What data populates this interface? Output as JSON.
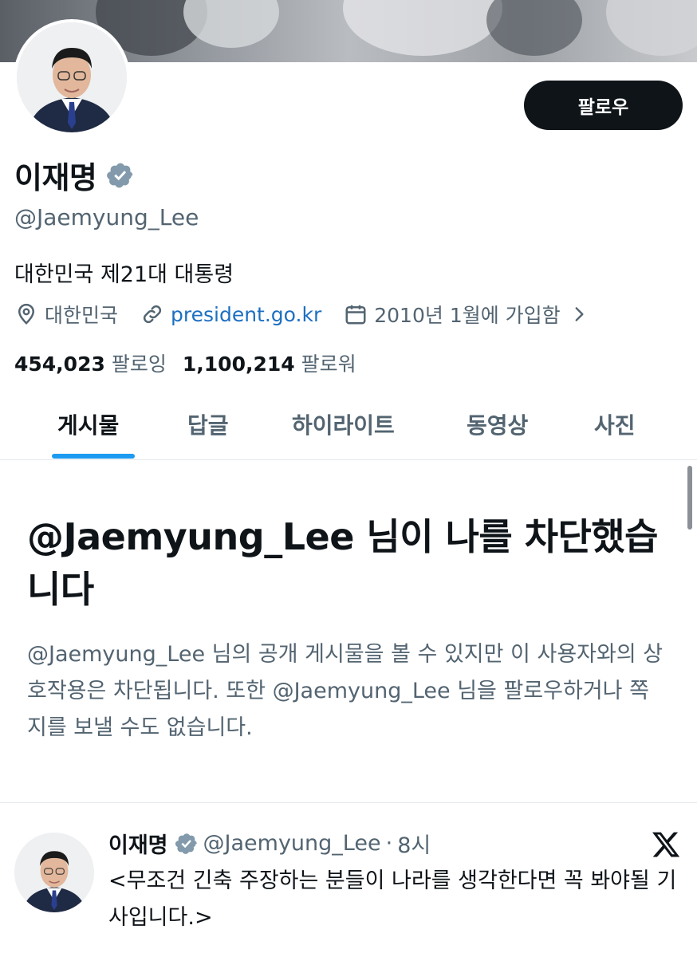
{
  "profile": {
    "display_name": "이재명",
    "handle": "@Jaemyung_Lee",
    "bio": "대한민국 제21대 대통령",
    "follow_button_label": "팔로우",
    "location": "대한민국",
    "website": "president.go.kr",
    "joined": "2010년 1월에 가입함",
    "following_count": "454,023",
    "following_label": "팔로잉",
    "followers_count": "1,100,214",
    "followers_label": "팔로워"
  },
  "tabs": [
    {
      "label": "게시물",
      "active": true
    },
    {
      "label": "답글",
      "active": false
    },
    {
      "label": "하이라이트",
      "active": false
    },
    {
      "label": "동영상",
      "active": false
    },
    {
      "label": "사진",
      "active": false
    }
  ],
  "blocked_notice": {
    "title": "@Jaemyung_Lee 님이 나를 차단했습니다",
    "description": "@Jaemyung_Lee 님의 공개 게시물을 볼 수 있지만 이 사용자와의 상호작용은 차단됩니다. 또한 @Jaemyung_Lee 님을 팔로우하거나 쪽지를 보낼 수도 없습니다."
  },
  "tweet": {
    "author_name": "이재명",
    "author_handle": "@Jaemyung_Lee",
    "separator": "·",
    "time": "8시",
    "text": "<무조건 긴축 주장하는 분들이 나라를 생각한다면 꼭 봐야될 기사입니다.>"
  },
  "icons": {
    "verified": "verified-badge-icon",
    "location": "location-pin-icon",
    "link": "link-icon",
    "calendar": "calendar-icon",
    "chevron": "chevron-right-icon",
    "brand": "x-logo-icon"
  },
  "colors": {
    "accent": "#1d9bf0",
    "verified_badge": "#829aab",
    "link": "#1d6fc2",
    "button_bg": "#0f1419",
    "secondary_text": "#536471"
  }
}
